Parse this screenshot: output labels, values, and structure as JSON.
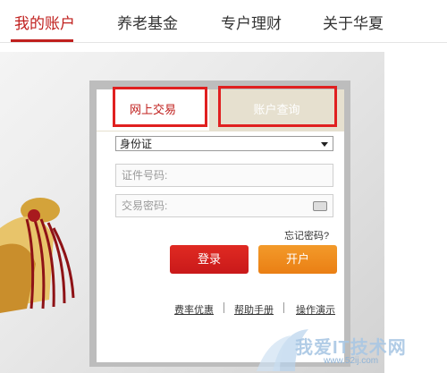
{
  "nav": {
    "items": [
      {
        "label": "我的账户"
      },
      {
        "label": "养老基金"
      },
      {
        "label": "专户理财"
      },
      {
        "label": "关于华夏"
      }
    ]
  },
  "login": {
    "tabs": [
      {
        "label": "网上交易"
      },
      {
        "label": "账户查询"
      }
    ],
    "id_type": "身份证",
    "id_placeholder": "证件号码:",
    "password_placeholder": "交易密码:",
    "forgot": "忘记密码?",
    "login_button": "登录",
    "open_button": "开户",
    "links": [
      "费率优惠",
      "帮助手册",
      "操作演示"
    ]
  },
  "watermark": {
    "text": "我爱IT技术网",
    "url": "www.52ij.com"
  },
  "colors": {
    "brand_red": "#c0201e",
    "login_red": "#d9231d",
    "open_orange": "#ee8a1c",
    "highlight_red": "#e02020"
  }
}
